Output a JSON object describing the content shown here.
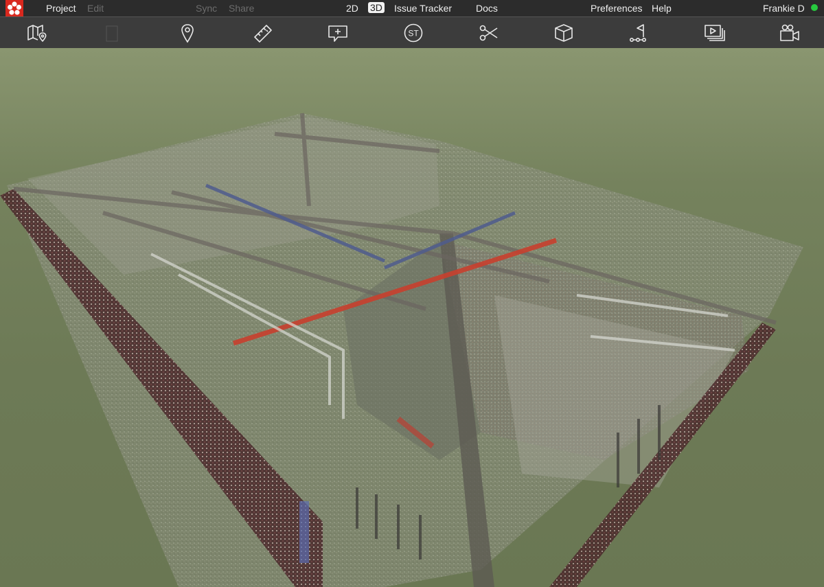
{
  "menubar": {
    "project": "Project",
    "edit": "Edit",
    "sync": "Sync",
    "share": "Share",
    "view_2d": "2D",
    "view_3d": "3D",
    "issue_tracker": "Issue Tracker",
    "docs": "Docs",
    "preferences": "Preferences",
    "help": "Help",
    "user": "Frankie D"
  },
  "toolbar": {
    "tools": [
      "map-pin-icon",
      "blank-tool-icon",
      "location-pin-icon",
      "ruler-icon",
      "add-comment-icon",
      "st-badge-icon",
      "scissors-icon",
      "box-icon",
      "path-flag-icon",
      "layers-icon",
      "video-camera-icon"
    ],
    "st_label": "ST"
  },
  "colors": {
    "menubar_bg": "#2c2c2c",
    "toolbar_bg": "#3c3c3c",
    "logo_red": "#d9281e",
    "status_online": "#27c93f",
    "viewport_bg": "#6f7c5c",
    "disabled_text": "#6c6c6c"
  },
  "viewport": {
    "mode": "3D point cloud"
  }
}
